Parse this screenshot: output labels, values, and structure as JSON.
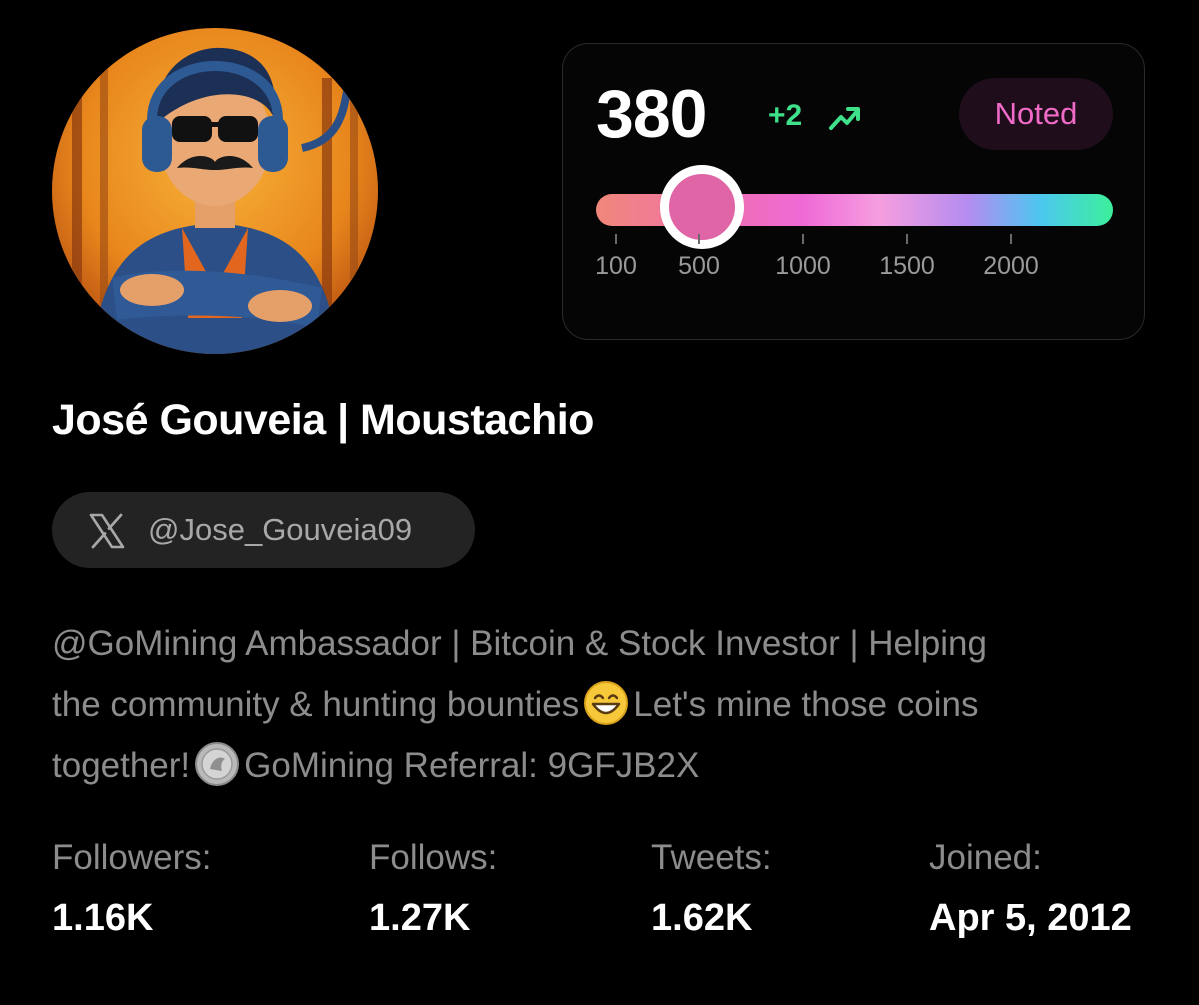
{
  "profile": {
    "avatar_icon": "avatar-illustration",
    "display_name": "José Gouveia | Moustachio",
    "handle_icon": "x-logo-icon",
    "handle": "@Jose_Gouveia09",
    "bio": {
      "line1": "@GoMining Ambassador | Bitcoin & Stock Investor | Helping",
      "line2_before": "the community & hunting bounties",
      "line2_emoji": "grinning-face-emoji",
      "line2_after": "Let's mine those coins",
      "line3_before": "together!",
      "line3_icon": "silver-coin-icon",
      "line3_after": "GoMining Referral: 9GFJB2X"
    }
  },
  "score": {
    "value": "380",
    "delta": "+2",
    "trend_icon": "trending-up-icon",
    "status": "Noted",
    "slider_value": 380,
    "ticks": [
      "100",
      "500",
      "1000",
      "1500",
      "2000"
    ]
  },
  "stats": [
    {
      "label": "Followers:",
      "value": "1.16K"
    },
    {
      "label": "Follows:",
      "value": "1.27K"
    },
    {
      "label": "Tweets:",
      "value": "1.62K"
    },
    {
      "label": "Joined:",
      "value": "Apr 5, 2012"
    }
  ],
  "colors": {
    "background": "#000000",
    "delta_green": "#3ee08a",
    "status_pink": "#f06ac8",
    "thumb_pink": "#e065a6"
  }
}
